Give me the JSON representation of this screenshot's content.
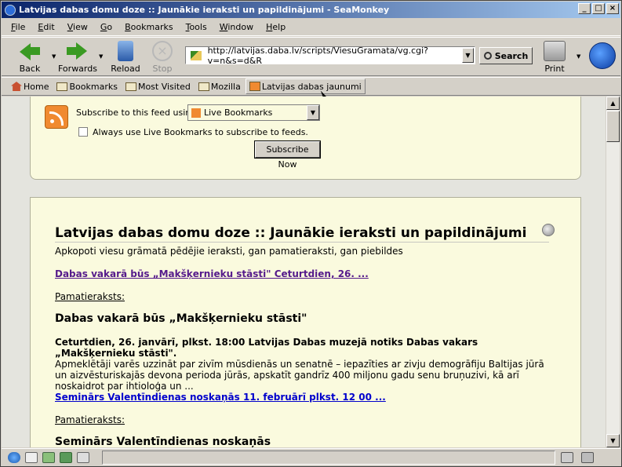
{
  "window": {
    "title": "Latvijas dabas domu doze :: Jaunākie ieraksti un papildinājumi - SeaMonkey"
  },
  "menu": [
    "File",
    "Edit",
    "View",
    "Go",
    "Bookmarks",
    "Tools",
    "Window",
    "Help"
  ],
  "nav": {
    "back": "Back",
    "forwards": "Forwards",
    "reload": "Reload",
    "stop": "Stop",
    "print": "Print",
    "search": "Search"
  },
  "url": "http://latvijas.daba.lv/scripts/ViesuGramata/vg.cgi?v=n&s=d&R",
  "bookmarks": [
    "Home",
    "Bookmarks",
    "Most Visited",
    "Mozilla",
    "Latvijas dabas jaunumi"
  ],
  "feed": {
    "subscribe_label": "Subscribe to this feed using",
    "reader": "Live Bookmarks",
    "always_label": "Always use Live Bookmarks to subscribe to feeds.",
    "subscribe_button": "Subscribe Now"
  },
  "page": {
    "title": "Latvijas dabas domu doze :: Jaunākie ieraksti un papildinājumi",
    "subtitle": "Apkopoti viesu grāmatā pēdējie ieraksti, gan pamatieraksti, gan piebildes",
    "entries": [
      {
        "link": "Dabas vakarā būs „Makšķernieku stāsti\" Ceturtdien, 26. ...",
        "label": "Pamatieraksts:",
        "heading": "Dabas vakarā būs „Makšķernieku stāsti\"",
        "lead": "Ceturtdien, 26. janvārī, plkst. 18:00 Latvijas Dabas muzejā notiks Dabas vakars „Makšķernieku stāsti\".",
        "body": "Apmeklētāji varēs uzzināt par zivīm mūsdienās un senatnē – iepazīties ar zivju demogrāfiju Baltijas jūrā un aizvēsturiskajās devona perioda jūrās, apskatīt gandrīz 400 miljonu gadu senu bruņuzivi, kā arī noskaidrot par ihtioloģa un ..."
      },
      {
        "link": "Seminārs Valentīndienas noskaņās 11. februārī plkst. 12 00 ...",
        "label": "Pamatieraksts:",
        "heading": "Seminārs Valentīndienas noskaņās"
      }
    ]
  }
}
